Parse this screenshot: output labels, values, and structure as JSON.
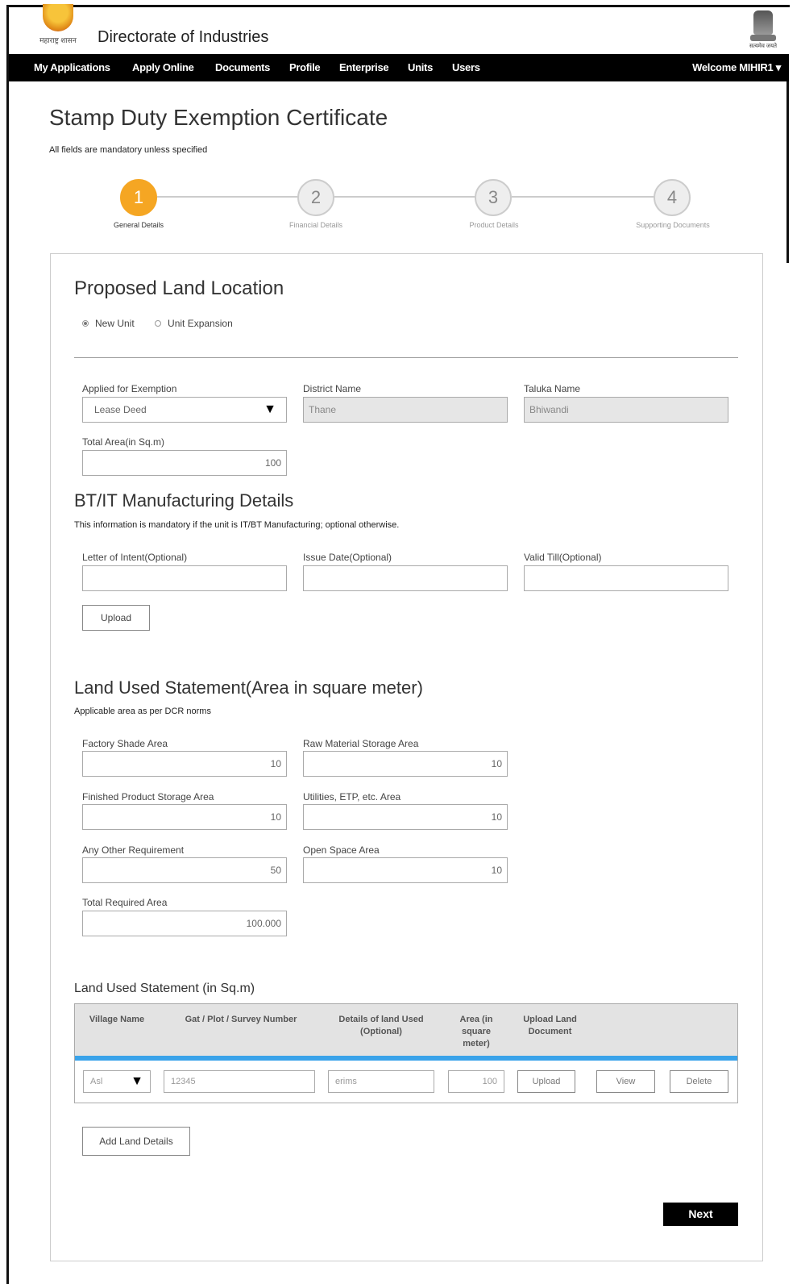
{
  "header": {
    "logo_caption": "महाराष्ट्र शासन",
    "brand": "Directorate of Industries",
    "emblem_caption": "सत्यमेव जयते"
  },
  "nav": {
    "items": [
      "My Applications",
      "Apply Online",
      "Documents",
      "Profile",
      "Enterprise",
      "Units",
      "Users"
    ],
    "welcome": "Welcome MIHIR1 ▾"
  },
  "page": {
    "title": "Stamp Duty Exemption Certificate",
    "mandatory_note": "All fields are mandatory unless specified"
  },
  "stepper": {
    "steps": [
      {
        "number": "1",
        "label": "General Details"
      },
      {
        "number": "2",
        "label": "Financial Details"
      },
      {
        "number": "3",
        "label": "Product Details"
      },
      {
        "number": "4",
        "label": "Supporting Documents"
      }
    ]
  },
  "location": {
    "title": "Proposed Land Location",
    "radio_new": "New Unit",
    "radio_expansion": "Unit Expansion",
    "applied_label": "Applied for Exemption",
    "applied_value": "Lease Deed",
    "district_label": "District Name",
    "district_value": "Thane",
    "taluka_label": "Taluka Name",
    "taluka_value": "Bhiwandi",
    "total_area_label": "Total Area(in Sq.m)",
    "total_area_value": "100"
  },
  "btit": {
    "title": "BT/IT Manufacturing Details",
    "hint": "This information is mandatory if the unit is IT/BT Manufacturing; optional otherwise.",
    "loi_label": "Letter of Intent(Optional)",
    "issue_label": "Issue Date(Optional)",
    "valid_label": "Valid Till(Optional)",
    "upload": "Upload"
  },
  "landused": {
    "title": "Land Used Statement(Area in square meter)",
    "hint": "Applicable area as per DCR norms",
    "factory_label": "Factory Shade Area",
    "factory_value": "10",
    "raw_label": "Raw Material Storage Area",
    "raw_value": "10",
    "finished_label": "Finished Product Storage Area",
    "finished_value": "10",
    "utilities_label": "Utilities, ETP, etc. Area",
    "utilities_value": "10",
    "other_label": "Any Other Requirement",
    "other_value": "50",
    "open_label": "Open Space Area",
    "open_value": "10",
    "total_label": "Total Required Area",
    "total_value": "100.000"
  },
  "table": {
    "title": "Land Used Statement (in Sq.m)",
    "headers": [
      "Village Name",
      "Gat / Plot / Survey Number",
      "Details of land Used (Optional)",
      "Area (in square meter)",
      "Upload Land Document"
    ],
    "row": {
      "village": "Asl",
      "gat": "12345",
      "details": "erims",
      "area": "100",
      "upload": "Upload",
      "view": "View",
      "delete": "Delete"
    },
    "add_button": "Add Land Details"
  },
  "footer": {
    "next": "Next"
  }
}
